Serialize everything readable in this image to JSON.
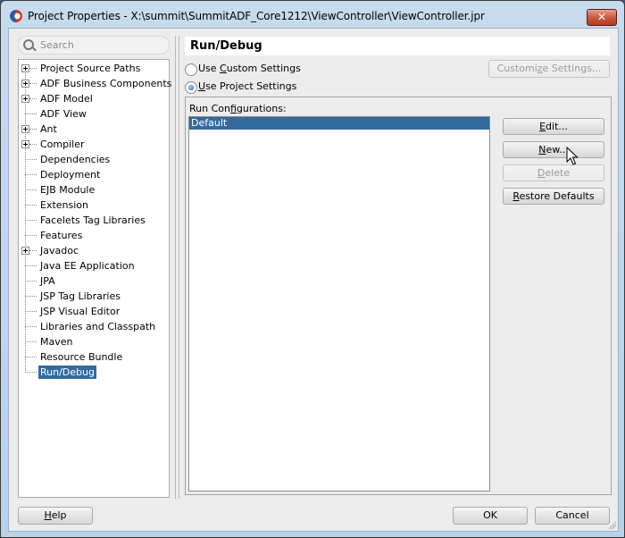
{
  "window": {
    "title": "Project Properties - X:\\summit\\SummitADF_Core1212\\ViewController\\ViewController.jpr",
    "close_label": "✕"
  },
  "search": {
    "placeholder": "Search"
  },
  "tree": {
    "items": [
      {
        "label": "Project Source Paths",
        "expandable": true
      },
      {
        "label": "ADF Business Components",
        "expandable": true
      },
      {
        "label": "ADF Model",
        "expandable": true
      },
      {
        "label": "ADF View",
        "expandable": false
      },
      {
        "label": "Ant",
        "expandable": true
      },
      {
        "label": "Compiler",
        "expandable": true
      },
      {
        "label": "Dependencies",
        "expandable": false
      },
      {
        "label": "Deployment",
        "expandable": false
      },
      {
        "label": "EJB Module",
        "expandable": false
      },
      {
        "label": "Extension",
        "expandable": false
      },
      {
        "label": "Facelets Tag Libraries",
        "expandable": false
      },
      {
        "label": "Features",
        "expandable": false
      },
      {
        "label": "Javadoc",
        "expandable": true
      },
      {
        "label": "Java EE Application",
        "expandable": false
      },
      {
        "label": "JPA",
        "expandable": false
      },
      {
        "label": "JSP Tag Libraries",
        "expandable": false
      },
      {
        "label": "JSP Visual Editor",
        "expandable": false
      },
      {
        "label": "Libraries and Classpath",
        "expandable": false
      },
      {
        "label": "Maven",
        "expandable": false
      },
      {
        "label": "Resource Bundle",
        "expandable": false
      },
      {
        "label": "Run/Debug",
        "expandable": false,
        "selected": true
      }
    ]
  },
  "panel": {
    "title": "Run/Debug",
    "radio_custom": {
      "pre": "Use ",
      "mnemonic": "C",
      "post": "ustom Settings",
      "checked": false
    },
    "radio_project": {
      "pre": "",
      "mnemonic": "U",
      "post": "se Project Settings",
      "checked": true
    },
    "customize_button": {
      "pre": "Customi",
      "mnemonic": "z",
      "post": "e Settings..."
    },
    "run_configs_label": {
      "pre": "Run Con",
      "mnemonic": "f",
      "post": "igurations:"
    },
    "run_configs": [
      {
        "label": "Default",
        "selected": true
      }
    ],
    "edit_button": {
      "pre": "",
      "mnemonic": "E",
      "post": "dit..."
    },
    "new_button": {
      "pre": "",
      "mnemonic": "N",
      "post": "ew..."
    },
    "delete_button": {
      "pre": "",
      "mnemonic": "D",
      "post": "elete"
    },
    "restore_button": {
      "pre": "",
      "mnemonic": "R",
      "post": "estore Defaults"
    }
  },
  "footer": {
    "help_button": {
      "pre": "",
      "mnemonic": "H",
      "post": "elp"
    },
    "ok_label": "OK",
    "cancel_label": "Cancel"
  }
}
